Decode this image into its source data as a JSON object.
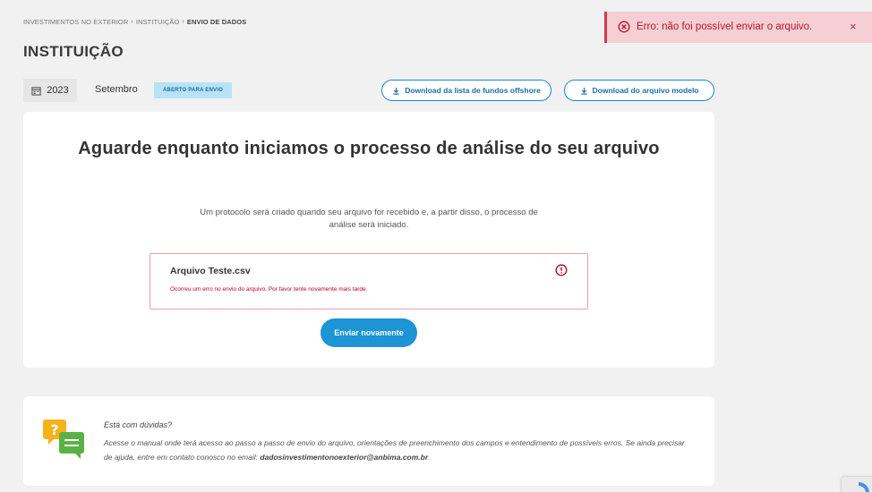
{
  "breadcrumb": {
    "items": [
      "INVESTIMENTOS NO EXTERIOR",
      "INSTITUIÇÃO",
      "ENVIO DE DADOS"
    ],
    "separator": "›"
  },
  "page": {
    "title": "INSTITUIÇÃO"
  },
  "toolbar": {
    "year": "2023",
    "year_icon": "calendar-icon",
    "month": "Setembro",
    "status": "ABERTO PARA ENVIO",
    "download_offshore_label": "Download da lista de fundos offshore",
    "download_model_label": "Download do arquivo modelo",
    "download_icon": "download-icon"
  },
  "main": {
    "title": "Aguarde enquanto iniciamos o processo de análise do seu arquivo",
    "subtitle": "Um protocolo será criado quando seu arquivo for recebido e, a partir disso, o processo de análise será iniciado.",
    "file": {
      "name": "Arquivo Teste.csv",
      "error": "Ocorreu um erro no envio do arquivo. Por favor tente novamente mais tarde.",
      "alert_icon": "alert-circle-icon"
    },
    "resend_label": "Enviar novamente"
  },
  "help": {
    "title": "Está com dúvidas?",
    "text": "Acesse o manual onde terá acesso ao passo a passo de envio do arquivo, orientações de preenchimento dos campos e entendimento de possíveis erros. Se ainda precisar de ajuda, entre em contato conosco no email: ",
    "email": "dadosinvestimentonoexterior@anbima.com.br",
    "suffix": ".",
    "icon": "chat-bubbles-icon"
  },
  "toast": {
    "message": "Erro: não foi possível enviar o arquivo.",
    "close": "×",
    "icon": "error-circle-icon"
  },
  "colors": {
    "accent": "#1c94d6",
    "error": "#b8142a",
    "badge_bg": "#b7e3f6",
    "toast_bg": "#f6cfd4"
  }
}
